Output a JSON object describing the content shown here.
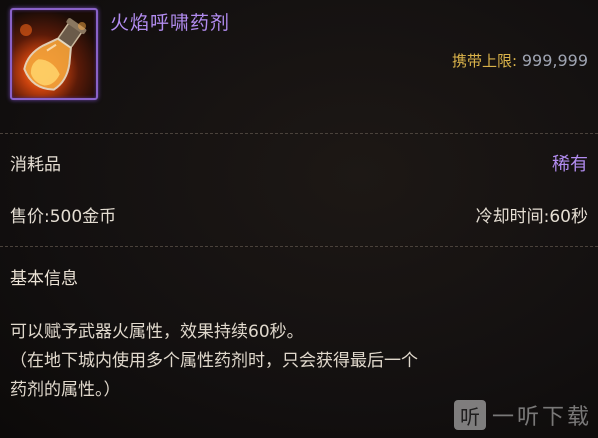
{
  "item": {
    "name": "火焰呼啸药剂",
    "icon": "fire-potion-icon",
    "carry_label": "携带上限:",
    "carry_value": "999,999"
  },
  "info": {
    "type": "消耗品",
    "rarity": "稀有",
    "price_label": "售价:",
    "price_value": "500金币",
    "cooldown_label": "冷却时间:",
    "cooldown_value": "60秒"
  },
  "basic": {
    "title": "基本信息",
    "lines": [
      "可以赋予武器火属性，效果持续60秒。",
      "（在地下城内使用多个属性药剂时，只会获得最后一个",
      "药剂的属性。）"
    ]
  },
  "watermark": {
    "logo": "听",
    "text": "一听下载"
  },
  "colors": {
    "rarity": "#b28cf0",
    "carry_label": "#d9b24a",
    "icon_border": "#8a62c8"
  }
}
